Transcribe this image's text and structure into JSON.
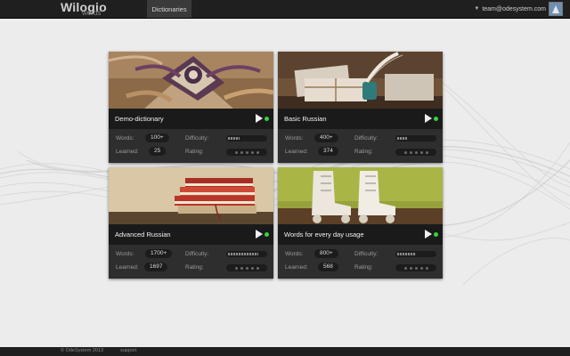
{
  "header": {
    "logo_name": "Wilogio",
    "logo_sub": "words",
    "nav_tab": "Dictionaries",
    "user_email": "team@odesystem.com"
  },
  "labels": {
    "words": "Words:",
    "learned": "Learned:",
    "difficulty": "Difficulty:",
    "rating": "Rating:"
  },
  "cards": [
    {
      "title": "Demo-dictionary",
      "words": "100+",
      "learned": "25",
      "difficulty_level": 0.3,
      "rating_stars": 0,
      "image": "gift-ribbons"
    },
    {
      "title": "Basic Russian",
      "words": "400+",
      "learned": "374",
      "difficulty_level": 0.25,
      "rating_stars": 0,
      "image": "letters-ink"
    },
    {
      "title": "Advanced Russian",
      "words": "1700+",
      "learned": "1697",
      "difficulty_level": 0.8,
      "rating_stars": 0,
      "image": "books-stack"
    },
    {
      "title": "Words for every day usage",
      "words": "800+",
      "learned": "568",
      "difficulty_level": 0.5,
      "rating_stars": 0,
      "image": "roller-skates"
    }
  ],
  "footer": {
    "copyright": "© OdeSystem 2013",
    "support": "support"
  },
  "colors": {
    "status_active": "#39d23a",
    "topbar": "#1f1f1f",
    "card_bg": "#262626"
  }
}
